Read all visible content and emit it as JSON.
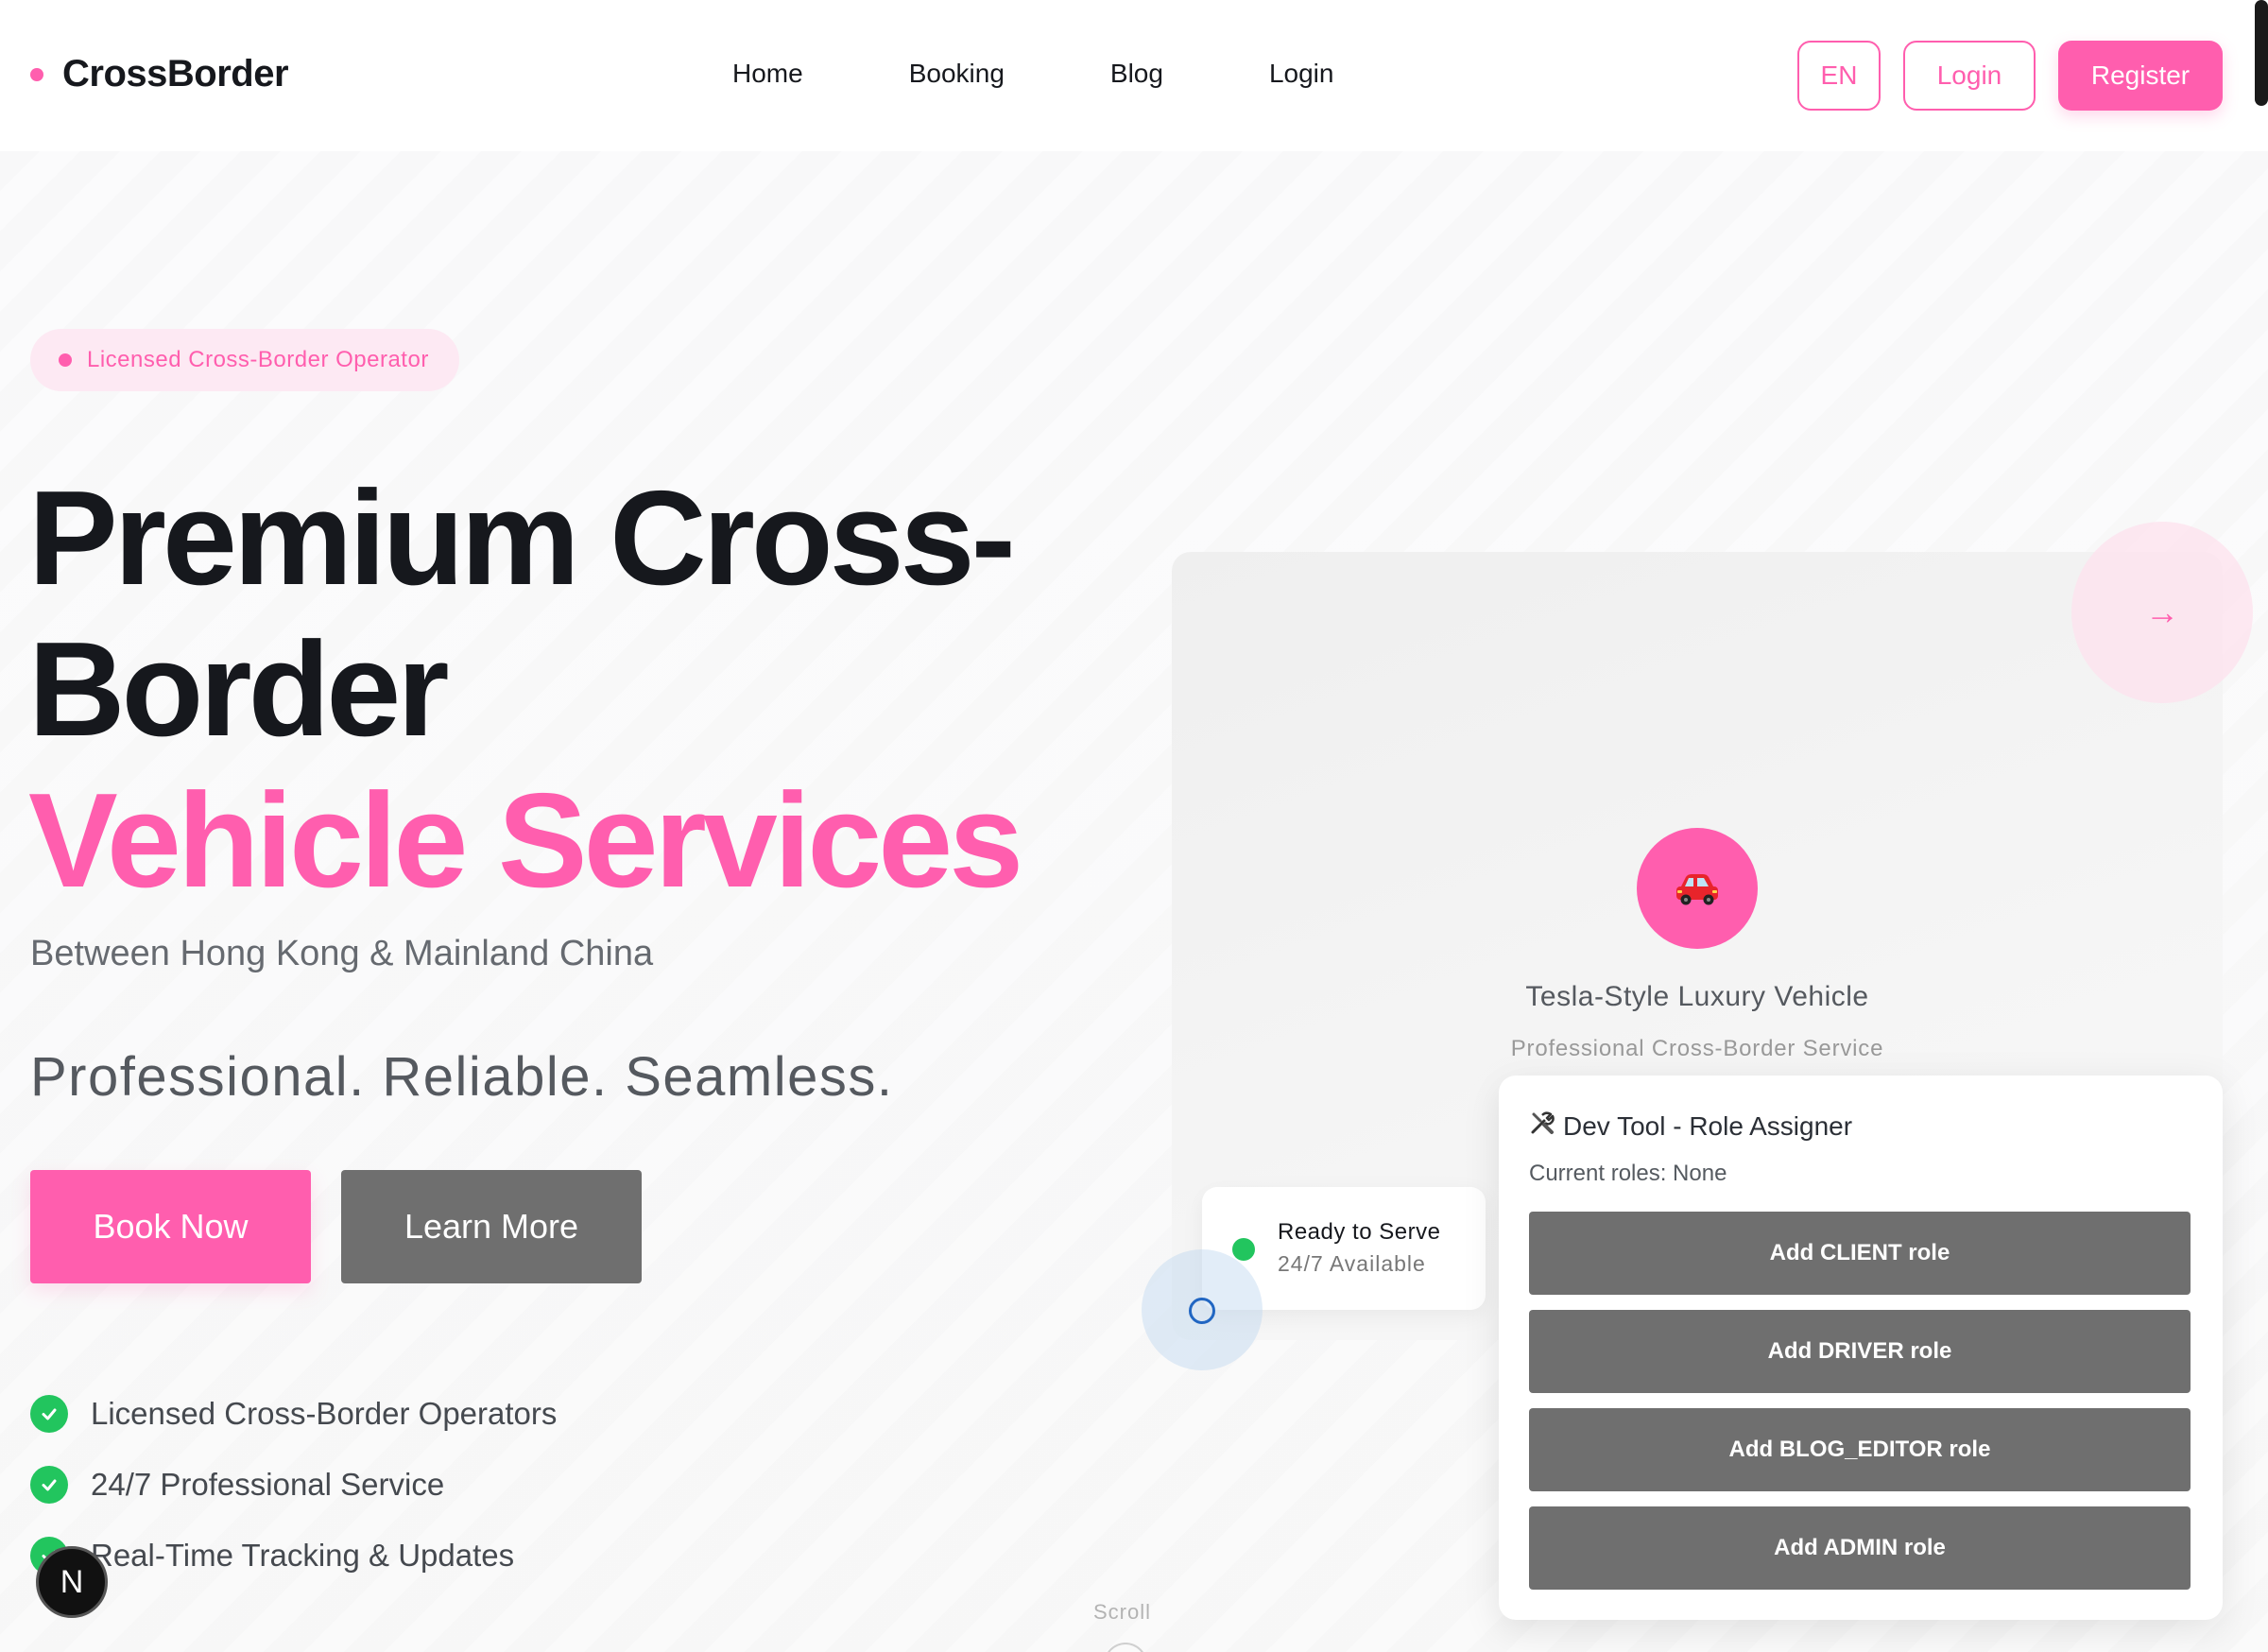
{
  "nav": {
    "brand": "CrossBorder",
    "links": [
      "Home",
      "Booking",
      "Blog",
      "Login"
    ],
    "lang_button": "EN",
    "login_button": "Login",
    "register_button": "Register"
  },
  "hero": {
    "badge": "Licensed Cross-Border Operator",
    "headline_line1": "Premium Cross-",
    "headline_line2": "Border",
    "headline_line3": "Vehicle Services",
    "subtitle": "Between Hong Kong & Mainland China",
    "tagline": "Professional. Reliable. Seamless.",
    "book_button": "Book Now",
    "learn_button": "Learn More",
    "features": [
      "Licensed Cross-Border Operators",
      "24/7 Professional Service",
      "Real-Time Tracking & Updates"
    ],
    "scroll_label": "Scroll"
  },
  "showcase": {
    "arrow_icon": "→",
    "car_icon": "🚗",
    "vehicle_title": "Tesla-Style Luxury Vehicle",
    "vehicle_subtitle": "Professional Cross-Border Service",
    "ready_title": "Ready to Serve",
    "ready_subtitle": "24/7 Available"
  },
  "devtool": {
    "icon": "🛠",
    "title": "Dev Tool - Role Assigner",
    "current_roles": "Current roles: None",
    "buttons": [
      "Add CLIENT role",
      "Add DRIVER role",
      "Add BLOG_EDITOR role",
      "Add ADMIN role"
    ]
  },
  "dev_badge": "N",
  "colors": {
    "accent": "#ff5eae",
    "success": "#22c55e",
    "button_gray": "#6f6f6f"
  }
}
